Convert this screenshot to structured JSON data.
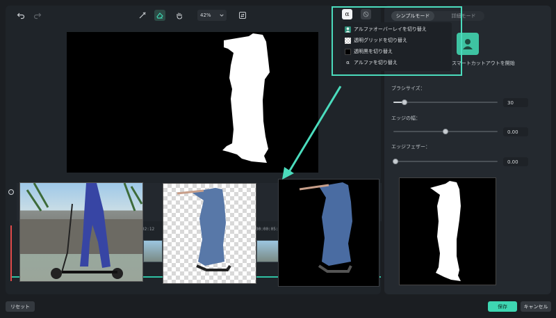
{
  "toolbar": {
    "zoom_value": "42%"
  },
  "timeline": {
    "ruler_marks": [
      "02:12",
      "00:00:05:0"
    ]
  },
  "mode_tabs": {
    "simple": "シンプルモード",
    "detail": "詳細モード"
  },
  "smart_cutout": {
    "label": "スマートカットアウトを開始"
  },
  "alpha_menu": {
    "button_glyph": "α",
    "items": [
      {
        "label": "アルファオーバーレイを切り替え",
        "icon": "person-overlay-icon"
      },
      {
        "label": "透明グリッドを切り替え",
        "icon": "grid-icon"
      },
      {
        "label": "透明黒を切り替え",
        "icon": "black-square-icon"
      },
      {
        "label": "アルファを切り替え",
        "icon": "alpha-icon",
        "glyph": "α"
      }
    ]
  },
  "brush": {
    "size_label": "ブラシサイズ：",
    "size_value": "30",
    "size_level": 0.1,
    "edge_width_label": "エッジの幅：",
    "edge_width_value": "0.00",
    "edge_width_level": 0.5,
    "edge_feather_label": "エッジフェザー：",
    "edge_feather_value": "0.00",
    "edge_feather_level": 0.0
  },
  "footer": {
    "reset": "リセット",
    "save": "保存",
    "cancel": "キャンセル"
  },
  "colors": {
    "accent": "#3ed6b2",
    "highlight": "#4bdcbd",
    "playhead": "#e14a4a"
  }
}
